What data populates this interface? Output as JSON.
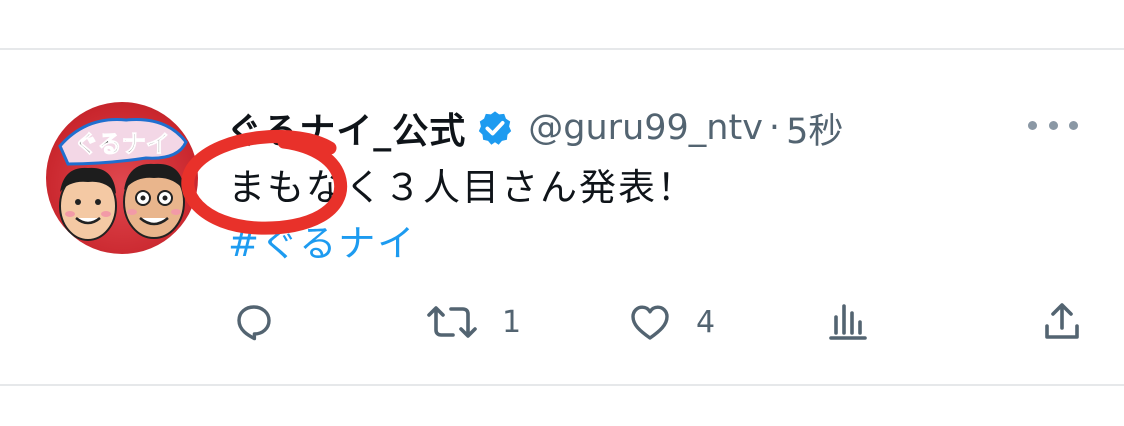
{
  "tweet": {
    "display_name": "ぐるナイ_公式",
    "handle": "@guru99_ntv",
    "separator": "·",
    "time": "5秒",
    "text": "まもなく３人目さん発表！",
    "hashtag": "#ぐるナイ",
    "avatar_label": "ぐるナイ"
  },
  "actions": {
    "reply_count": "",
    "retweet_count": "1",
    "like_count": "4"
  },
  "colors": {
    "verified": "#1d9bf0",
    "hashtag": "#1d9bf0",
    "annotation": "#e8312a",
    "secondary_text": "#536471"
  },
  "icons": [
    "avatar-image",
    "verified-badge-icon",
    "more-options-icon",
    "reply-icon",
    "retweet-icon",
    "like-icon",
    "analytics-icon",
    "share-icon"
  ]
}
